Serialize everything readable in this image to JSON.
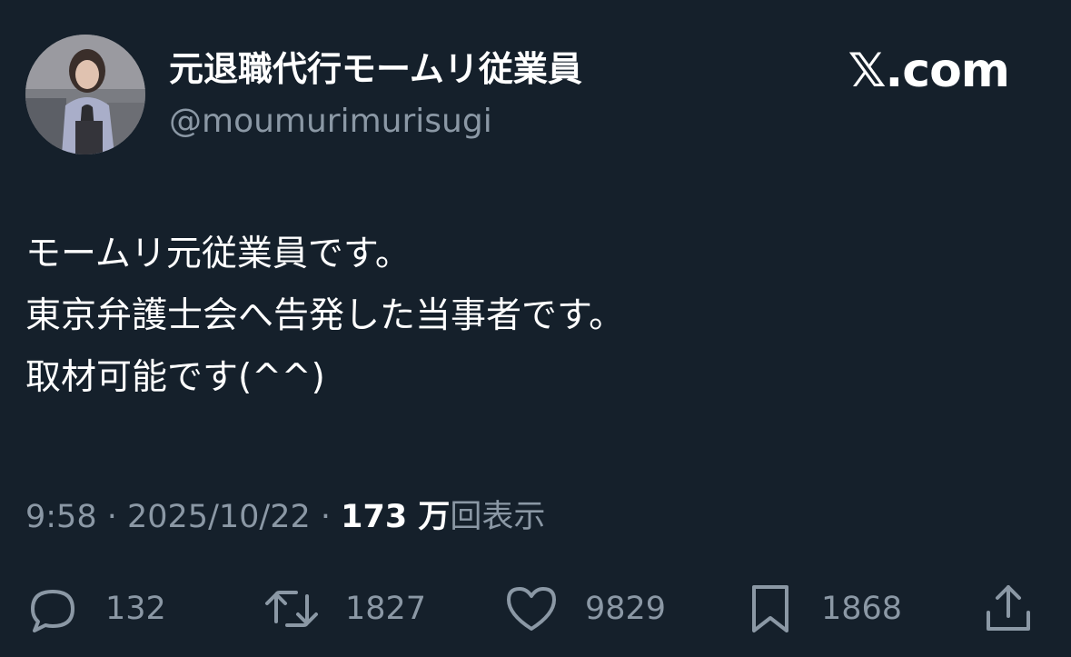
{
  "header": {
    "display_name": "元退職代行モームリ従業員",
    "handle": "@moumurimurisugi",
    "brand": "𝕏.com"
  },
  "tweet": {
    "lines": [
      "モームリ元従業員です。",
      "東京弁護士会へ告発した当事者です。",
      "取材可能です(^^)"
    ]
  },
  "meta": {
    "time": "9:58",
    "separator": " · ",
    "date": "2025/10/22",
    "views_count": "173 万",
    "views_label": "回表示"
  },
  "actions": {
    "reply_count": "132",
    "retweet_count": "1827",
    "like_count": "9829",
    "bookmark_count": "1868"
  },
  "colors": {
    "background": "#15202b",
    "primary_text": "#ffffff",
    "secondary_text": "#8b98a5"
  },
  "icons": [
    "reply-icon",
    "retweet-icon",
    "like-icon",
    "bookmark-icon",
    "share-icon"
  ]
}
